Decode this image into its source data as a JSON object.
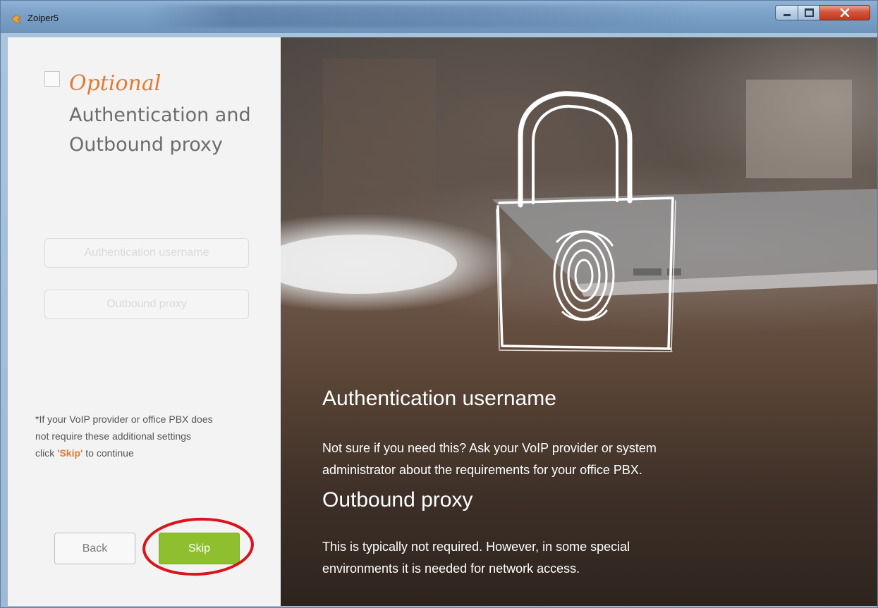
{
  "window": {
    "title": "Zoiper5",
    "controls": {
      "minimize_icon": "minimize-icon",
      "maximize_icon": "maximize-icon",
      "close_icon": "close-icon"
    }
  },
  "left": {
    "optional_label": "Optional",
    "heading_line1": "Authentication and",
    "heading_line2": "Outbound proxy",
    "auth_username_placeholder": "Authentication username",
    "outbound_proxy_placeholder": "Outbound proxy",
    "note_line1": "*If your VoIP provider or office PBX does",
    "note_line2": "not require these additional settings",
    "note_line3_prefix": "click ",
    "note_line3_skip": "'Skip'",
    "note_line3_suffix": " to continue",
    "back_label": "Back",
    "skip_label": "Skip"
  },
  "right": {
    "auth_heading": "Authentication username",
    "auth_text_line1": "Not sure if you need this? Ask your VoIP provider or system",
    "auth_text_line2": "administrator about the requirements for your office PBX.",
    "proxy_heading": "Outbound proxy",
    "proxy_text_line1": "This is typically not required. However, in some special",
    "proxy_text_line2": "environments it is needed for network access.",
    "illustration_icon": "padlock-fingerprint-icon"
  },
  "colors": {
    "accent_orange": "#e07a35",
    "skip_green": "#8dbf2f",
    "annotation_red": "#d8141c"
  }
}
